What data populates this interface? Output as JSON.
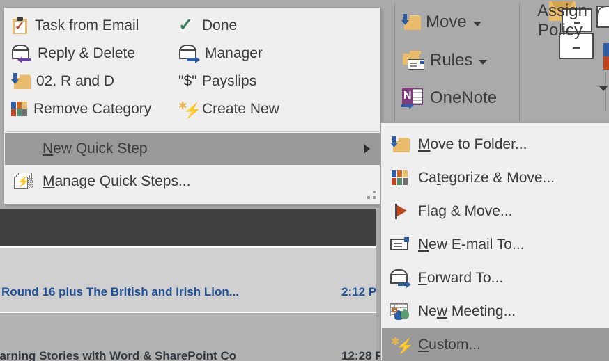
{
  "app": {
    "context": "Microsoft Outlook — Quick Steps gallery with New Quick Step submenu open"
  },
  "colors": {
    "ribbon_background": "#aaaaaa",
    "menu_background": "#efefef",
    "menu_border": "#a0a0a0",
    "highlight": "#9a9a9a",
    "text": "#3b3b3b",
    "mail_subject_blue": "#1f5199",
    "gold": "#e8bc6a",
    "category_blue": "#2c5fa8",
    "category_orange": "#d4691e",
    "category_red": "#c1441e",
    "category_green": "#4f8f72",
    "category_gray": "#6e6e6e",
    "dark_band": "#414141",
    "mail_row": "#d0d0d0",
    "mail_row_alt": "#b2b2b2"
  },
  "quick_steps_gallery": {
    "items": [
      {
        "label": "Task from Email",
        "icon": "task-from-email-icon"
      },
      {
        "label": "Done",
        "icon": "done-check-icon"
      },
      {
        "label": "Reply & Delete",
        "icon": "reply-delete-icon"
      },
      {
        "label": "Manager",
        "icon": "forward-manager-icon"
      },
      {
        "label": "02. R and D",
        "icon": "move-to-folder-icon"
      },
      {
        "label": "Payslips",
        "icon": "dollar-payslips-icon"
      },
      {
        "label": "Remove Category",
        "icon": "category-squares-icon"
      },
      {
        "label": "Create New",
        "icon": "lightning-create-new-icon"
      }
    ],
    "menu_items": [
      {
        "label_prefix": "",
        "accel": "N",
        "label_suffix": "ew Quick Step",
        "has_submenu": true,
        "highlighted": true,
        "icon": null
      },
      {
        "label_prefix": "",
        "accel": "M",
        "label_suffix": "anage Quick Steps...",
        "has_submenu": false,
        "highlighted": false,
        "icon": "manage-quick-steps-icon"
      }
    ]
  },
  "new_quick_step_submenu": {
    "items": [
      {
        "label_prefix": "",
        "accel": "M",
        "label_suffix": "ove to Folder...",
        "icon": "move-to-folder-icon",
        "highlighted": false
      },
      {
        "label_prefix": "Ca",
        "accel": "t",
        "label_suffix": "egorize & Move...",
        "icon": "category-squares-icon",
        "highlighted": false
      },
      {
        "label_prefix": "Fla",
        "accel": "g",
        "label_suffix": " & Move...",
        "icon": "flag-icon",
        "highlighted": false
      },
      {
        "label_prefix": "",
        "accel": "N",
        "label_suffix": "ew E-mail To...",
        "icon": "new-email-icon",
        "highlighted": false
      },
      {
        "label_prefix": "",
        "accel": "F",
        "label_suffix": "orward To...",
        "icon": "forward-envelope-icon",
        "highlighted": false
      },
      {
        "label_prefix": "Ne",
        "accel": "w",
        "label_suffix": " Meeting...",
        "icon": "new-meeting-icon",
        "highlighted": false
      },
      {
        "label_prefix": "",
        "accel": "C",
        "label_suffix": "ustom...",
        "icon": "lightning-custom-icon",
        "highlighted": true
      }
    ]
  },
  "ribbon": {
    "move_group": [
      {
        "label": "Move",
        "icon": "move-folder-icon",
        "has_dropdown": true
      },
      {
        "label": "Rules",
        "icon": "rules-icon",
        "has_dropdown": true
      },
      {
        "label": "OneNote",
        "icon": "onenote-icon",
        "has_dropdown": false
      }
    ],
    "assign_policy": {
      "line1": "Assign",
      "line2": "Policy",
      "icon": "assign-policy-icon",
      "has_dropdown": true
    }
  },
  "mail_list": {
    "rows": [
      {
        "subject": "Round 16 plus The British and Irish Lion...",
        "time": "2:12 P",
        "unread": true
      },
      {
        "subject": "earning Stories with Word & SharePoint Co",
        "time": "12:28 P",
        "unread": false
      }
    ]
  }
}
